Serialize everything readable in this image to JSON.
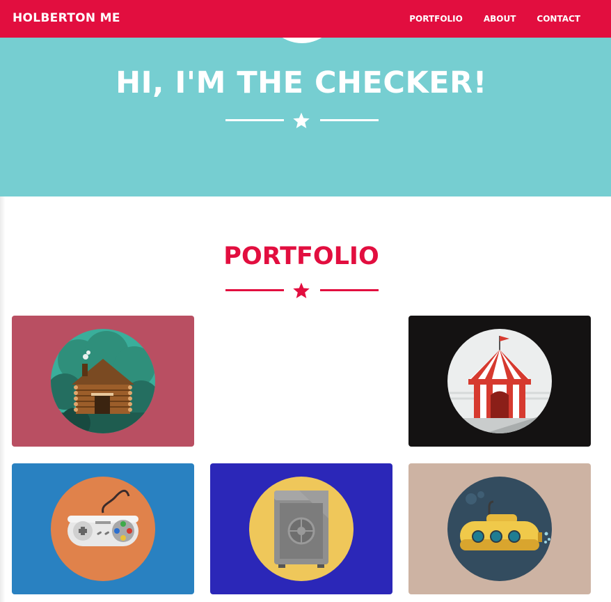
{
  "nav": {
    "brand": "HOLBERTON ME",
    "links": [
      "PORTFOLIO",
      "ABOUT",
      "CONTACT"
    ],
    "color": "#e20e3f"
  },
  "hero": {
    "title": "HI, I'M THE CHECKER!",
    "background": "#76ced1",
    "divider_icon": "star-icon"
  },
  "portfolio": {
    "title": "PORTFOLIO",
    "divider_icon": "star-icon",
    "items": [
      {
        "icon": "cabin-icon",
        "background": "#b94f62"
      },
      {
        "icon": "circus-tent-icon",
        "background": "#141212"
      },
      {
        "icon": "game-controller-icon",
        "background": "#2981c1"
      },
      {
        "icon": "safe-icon",
        "background": "#2b27b8"
      },
      {
        "icon": "submarine-icon",
        "background": "#cdb3a3"
      }
    ]
  }
}
